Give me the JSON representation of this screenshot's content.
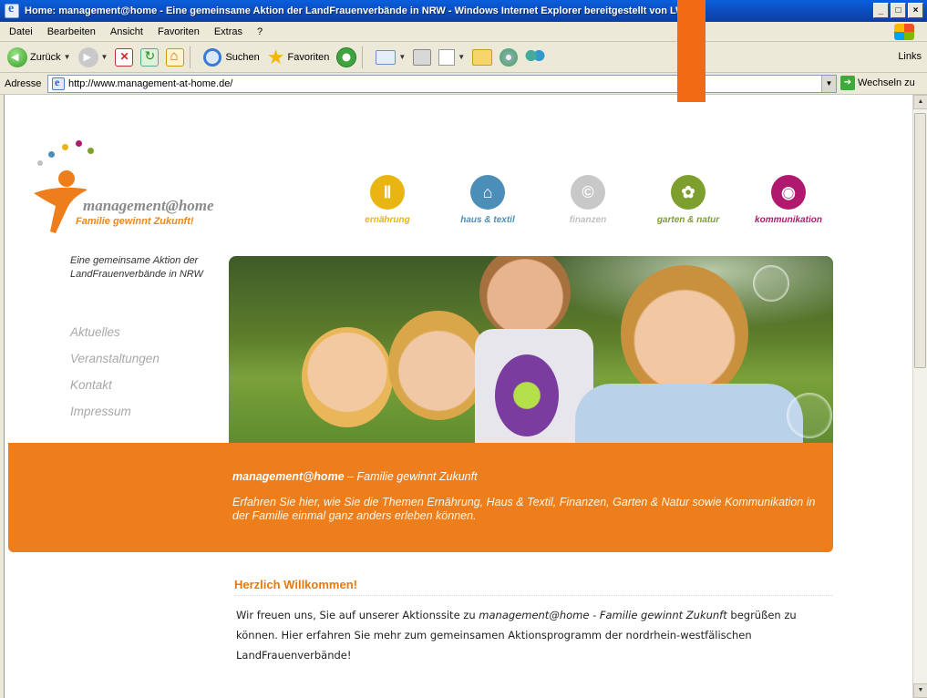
{
  "window": {
    "title": "Home: management@home - Eine gemeinsame Aktion der LandFrauenverbände in NRW - Windows Internet Explorer bereitgestellt von LWL",
    "buttons": [
      "_",
      "□",
      "×"
    ]
  },
  "menu": {
    "items": [
      "Datei",
      "Bearbeiten",
      "Ansicht",
      "Favoriten",
      "Extras",
      "?"
    ]
  },
  "toolbar": {
    "back_label": "Zurück",
    "search_label": "Suchen",
    "favorites_label": "Favoriten",
    "links_label": "Links"
  },
  "address": {
    "label": "Adresse",
    "url": "http://www.management-at-home.de/",
    "go_label": "Wechseln zu"
  },
  "site": {
    "brand": "management@home",
    "tagline": "Familie gewinnt Zukunft!",
    "intro": "Eine gemeinsame Aktion der LandFrauenverbände in NRW",
    "nav": [
      "Aktuelles",
      "Veranstaltungen",
      "Kontakt",
      "Impressum"
    ],
    "categories": [
      {
        "label": "ernährung",
        "color": "#e8b512"
      },
      {
        "label": "haus & textil",
        "color": "#4b8fb8"
      },
      {
        "label": "finanzen",
        "color": "#c0c0c0"
      },
      {
        "label": "garten & natur",
        "color": "#7d9f2e"
      },
      {
        "label": "kommunikation",
        "color": "#b01a6e"
      }
    ],
    "banner": {
      "title_bold": "management@home",
      "title_rest": " – Familie gewinnt Zukunft",
      "text": "Erfahren Sie hier, wie Sie die Themen Ernährung, Haus & Textil, Finanzen, Garten & Natur sowie Kommunikation in der Familie einmal ganz anders erleben können."
    },
    "welcome": {
      "heading": "Herzlich Willkommen!",
      "text_1": "Wir freuen uns, Sie auf unserer Aktionssite zu ",
      "text_italic": "management@home - Familie gewinnt Zukunft",
      "text_2": " begrüßen zu können. Hier erfahren Sie mehr zum gemeinsamen Aktionsprogramm der nordrhein-westfälischen LandFrauenverbände!"
    }
  },
  "colors": {
    "accent_orange": "#ee7d1b",
    "heading_orange": "#e8780e",
    "nav_gray": "#a8a8a8"
  }
}
